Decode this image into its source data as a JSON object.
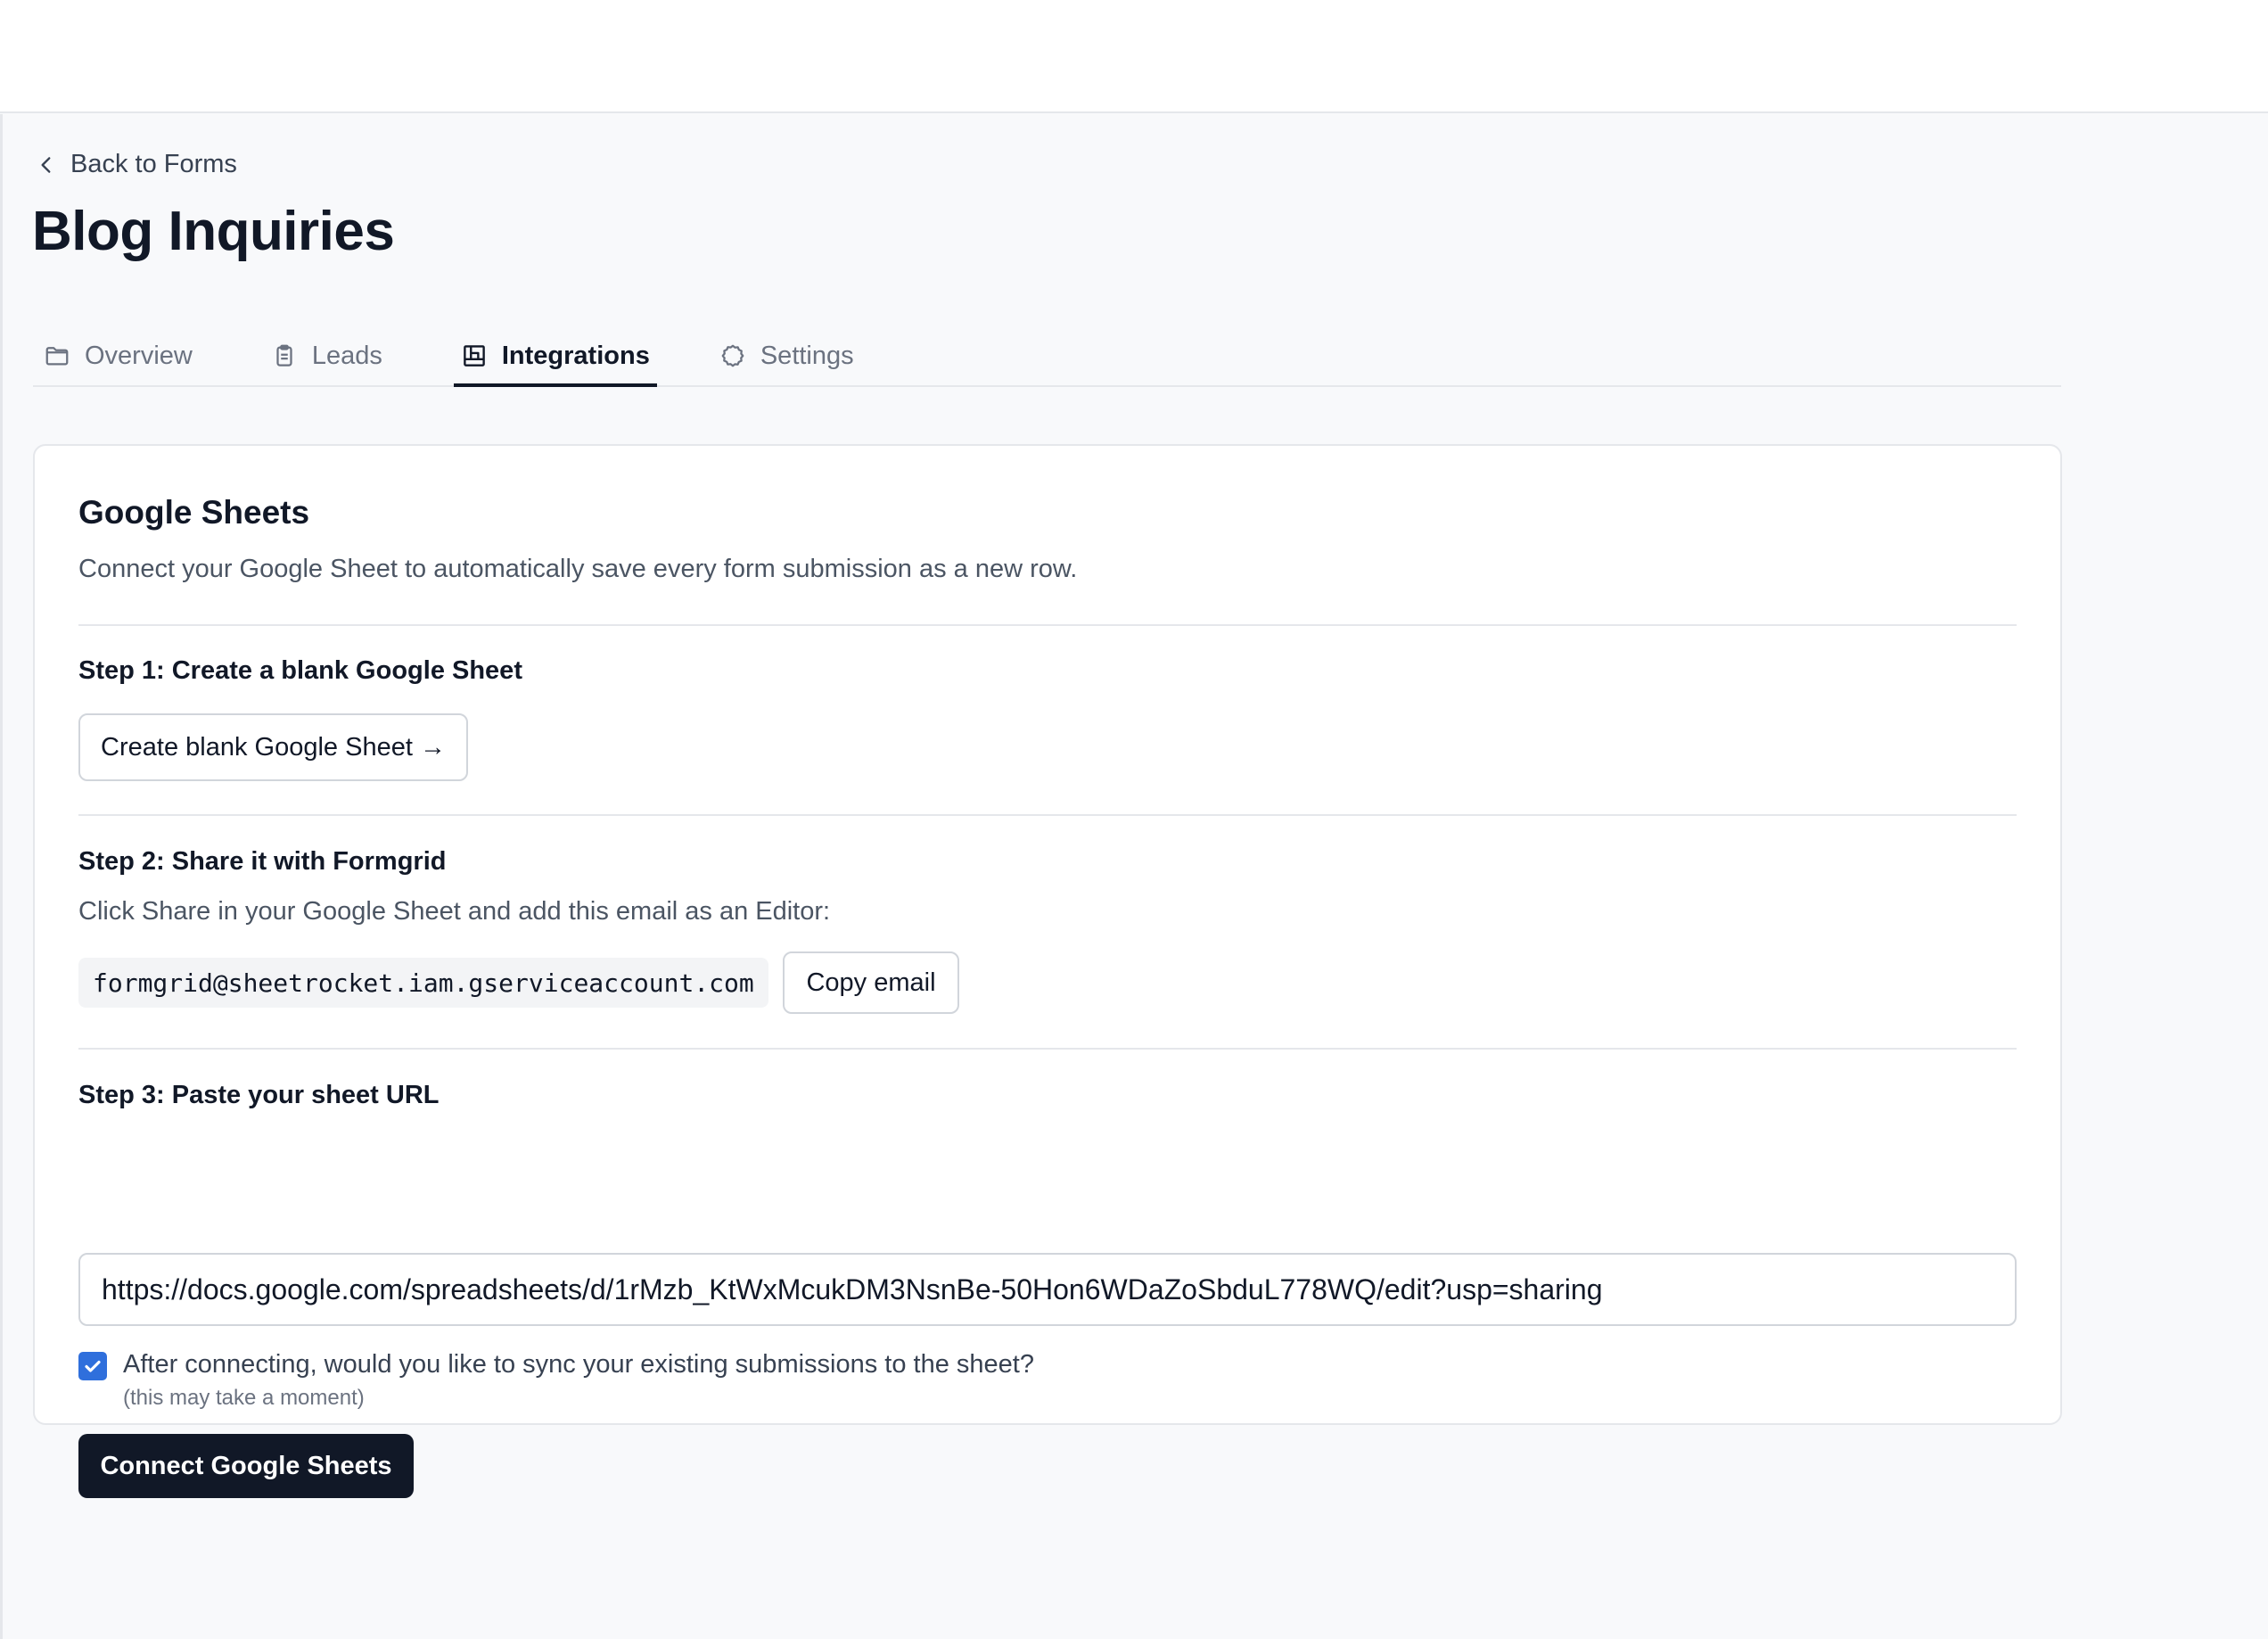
{
  "header": {
    "back_label": "Back to Forms",
    "title": "Blog Inquiries"
  },
  "tabs": [
    {
      "label": "Overview",
      "icon": "folder-icon",
      "active": false
    },
    {
      "label": "Leads",
      "icon": "clipboard-icon",
      "active": false
    },
    {
      "label": "Integrations",
      "icon": "integrations-icon",
      "active": true
    },
    {
      "label": "Settings",
      "icon": "gear-icon",
      "active": false
    }
  ],
  "card": {
    "title": "Google Sheets",
    "description": "Connect your Google Sheet to automatically save every form submission as a new row.",
    "step1": {
      "title": "Step 1: Create a blank Google Sheet",
      "button_label": "Create blank Google Sheet →"
    },
    "step2": {
      "title": "Step 2: Share it with Formgrid",
      "text": "Click Share in your Google Sheet and add this email as an Editor:",
      "email": "formgrid@sheetrocket.iam.gserviceaccount.com",
      "copy_label": "Copy email"
    },
    "step3": {
      "title": "Step 3: Paste your sheet URL",
      "url_value": "https://docs.google.com/spreadsheets/d/1rMzb_KtWxMcukDM3NsnBe-50Hon6WDaZoSbduL778WQ/edit?usp=sharing",
      "sync_checked": true,
      "sync_label": "After connecting, would you like to sync your existing submissions to the sheet?",
      "sync_note": "(this may take a moment)",
      "connect_label": "Connect Google Sheets"
    }
  },
  "colors": {
    "accent": "#2f6fdc",
    "primary_button": "#111827",
    "background": "#f8f9fb"
  }
}
